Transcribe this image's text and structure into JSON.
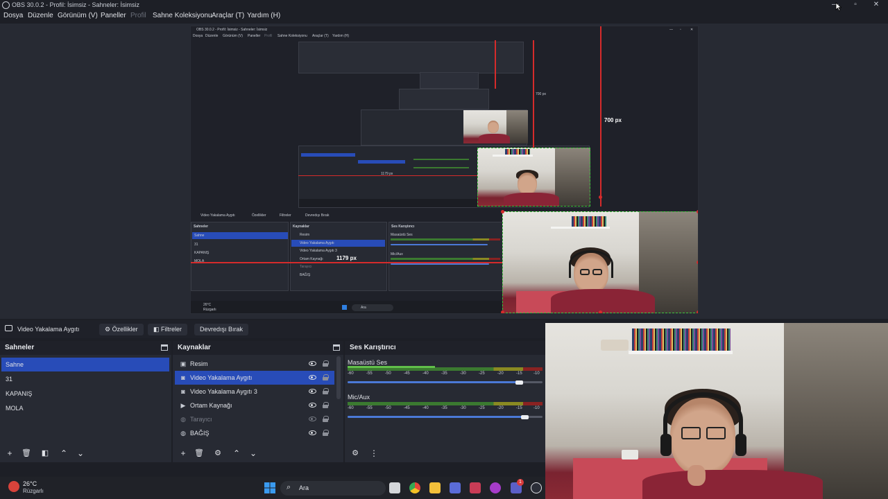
{
  "window": {
    "title": "OBS 30.0.2 - Profil: İsimsiz - Sahneler: İsimsiz"
  },
  "menu": [
    "Dosya",
    "Düzenle",
    "Görünüm (V)",
    "Paneller",
    "Profil",
    "Sahne Koleksiyonu",
    "Araçlar (T)",
    "Yardım (H)"
  ],
  "preview": {
    "nested_title": "OBS 30.0.2 - Profil: İsimsiz - Sahneler: İsimsiz",
    "nested_menu": [
      "Dosya",
      "Düzenle",
      "Görünüm (V)",
      "Paneller",
      "Profil",
      "Sahne Koleksiyonu",
      "Araçlar (T)",
      "Yardım (H)"
    ],
    "measure_height": "700 px",
    "measure_width": "1179 px",
    "measure_height_small": "700 px",
    "measure_width_small": "1179 px",
    "nested_toolbar": [
      "Video Yakalama Aygıtı",
      "Özellikler",
      "Filtreler",
      "Devredışı Bırak"
    ],
    "nested_scenes_title": "Sahneler",
    "nested_sources_title": "Kaynaklar",
    "nested_mixer_title": "Ses Karıştırıcı",
    "nested_scenes": [
      "Sahne",
      "31",
      "KAPANIŞ",
      "MOLA"
    ],
    "nested_sources": [
      "Resim",
      "Video Yakalama Aygıtı",
      "Video Yakalama Aygıtı 3",
      "Ortam Kaynağı",
      "Tarayıcı",
      "BAĞIŞ"
    ],
    "nested_mixer_tracks": [
      "Masaüstü Ses",
      "Mic/Aux"
    ],
    "nested_weather": "26°C",
    "nested_weather_desc": "Rüzgarlı",
    "nested_search": "Ara"
  },
  "toolbar": {
    "source_name": "Video Yakalama Aygıtı",
    "properties": "Özellikler",
    "filters": "Filtreler",
    "disable": "Devredışı Bırak"
  },
  "scenes": {
    "title": "Sahneler",
    "items": [
      "Sahne",
      "31",
      "KAPANIŞ",
      "MOLA"
    ],
    "selected_index": 0
  },
  "sources": {
    "title": "Kaynaklar",
    "items": [
      {
        "label": "Resim",
        "icon": "image-icon",
        "visible": true
      },
      {
        "label": "Video Yakalama Aygıtı",
        "icon": "camera-icon",
        "visible": true,
        "selected": true
      },
      {
        "label": "Video Yakalama Aygıtı 3",
        "icon": "camera-icon",
        "visible": true
      },
      {
        "label": "Ortam Kaynağı",
        "icon": "play-icon",
        "visible": true
      },
      {
        "label": "Tarayıcı",
        "icon": "globe-icon",
        "visible": false
      },
      {
        "label": "BAĞIŞ",
        "icon": "globe-icon",
        "visible": true
      }
    ]
  },
  "mixer": {
    "title": "Ses Karıştırıcı",
    "scale": [
      "-60",
      "-55",
      "-50",
      "-45",
      "-40",
      "-35",
      "-30",
      "-25",
      "-20",
      "-15",
      "-10"
    ],
    "tracks": [
      {
        "name": "Masaüstü Ses",
        "level": 0.45,
        "volume": 0.89
      },
      {
        "name": "Mic/Aux",
        "level": 0.0,
        "volume": 0.91
      }
    ]
  },
  "taskbar": {
    "weather_temp": "26°C",
    "weather_desc": "Rüzgarlı",
    "search_placeholder": "Ara",
    "notification_count": "1"
  },
  "colors": {
    "selection": "#284cb8",
    "measure_red": "#d62b2b",
    "bounds_green": "#3cc43c",
    "panel_bg": "#272a33",
    "window_bg": "#1d1f26"
  }
}
